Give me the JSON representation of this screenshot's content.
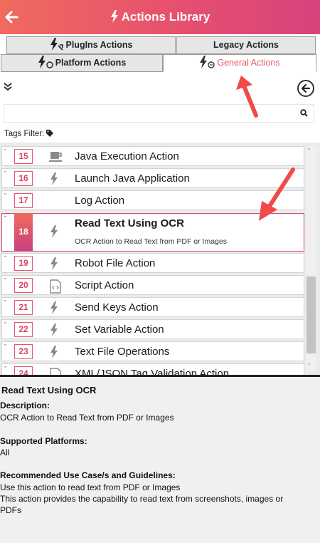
{
  "header": {
    "title": "Actions Library"
  },
  "tabs": [
    {
      "label": "PlugIns Actions",
      "active": false
    },
    {
      "label": "Legacy Actions",
      "active": false
    },
    {
      "label": "Platform Actions",
      "active": false
    },
    {
      "label": "General Actions",
      "active": true
    }
  ],
  "search": {
    "placeholder": ""
  },
  "tags_filter": {
    "label": "Tags Filter:"
  },
  "actions": [
    {
      "num": "15",
      "label": "Java Execution Action",
      "icon": "coffee-icon"
    },
    {
      "num": "16",
      "label": "Launch Java Application",
      "icon": "bolt-icon"
    },
    {
      "num": "17",
      "label": "Log Action",
      "icon": "none"
    },
    {
      "num": "18",
      "label": "Read Text Using OCR",
      "icon": "bolt-icon",
      "expanded": true,
      "description": "OCR Action to Read Text from PDF or Images"
    },
    {
      "num": "19",
      "label": "Robot File Action",
      "icon": "bolt-icon"
    },
    {
      "num": "20",
      "label": "Script Action",
      "icon": "script-file-icon"
    },
    {
      "num": "21",
      "label": "Send Keys Action",
      "icon": "bolt-icon"
    },
    {
      "num": "22",
      "label": "Set Variable Action",
      "icon": "bolt-icon"
    },
    {
      "num": "23",
      "label": "Text File Operations",
      "icon": "bolt-icon"
    },
    {
      "num": "24",
      "label": "XML/JSON Tag Validation Action",
      "icon": "file-icon"
    }
  ],
  "details": {
    "title": "Read Text Using OCR",
    "description_heading": "Description:",
    "description": "OCR Action to Read Text from PDF or Images",
    "platforms_heading": "Supported Platforms:",
    "platforms": "All",
    "usecase_heading": "Recommended Use Case/s and Guidelines:",
    "usecase_line1": "Use this action to read text from PDF or Images",
    "usecase_line2": "This action provides the capability to read text from screenshots, images or",
    "usecase_line3": "PDFs"
  },
  "colors": {
    "accent": "#e8566b",
    "header_start": "#f06b5e",
    "header_end": "#d8437d",
    "annotation_arrow": "#f04a4a"
  }
}
